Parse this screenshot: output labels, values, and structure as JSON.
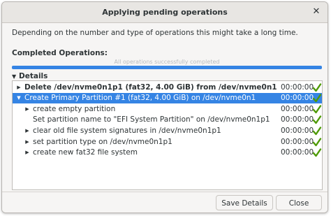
{
  "dialog": {
    "title": "Applying pending operations",
    "close_glyph": "✕",
    "message": "Depending on the number and type of operations this might take a long time."
  },
  "completed": {
    "label": "Completed Operations:",
    "status_text": "All operations successfully completed",
    "progress_percent": 100,
    "bar_color": "#3584e4"
  },
  "details": {
    "arrow": "▼",
    "label": "Details"
  },
  "operations": [
    {
      "expander": "▶",
      "label": "Delete /dev/nvme0n1p1 (fat32, 4.00 GiB) from /dev/nvme0n1",
      "time": "00:00:00",
      "level": 0,
      "bold": true,
      "selected": false,
      "icon": "check-icon"
    },
    {
      "expander": "▼",
      "label": "Create Primary Partition #1 (fat32, 4.00 GiB) on /dev/nvme0n1",
      "time": "00:00:00",
      "level": 0,
      "bold": false,
      "selected": true,
      "icon": "check-icon"
    },
    {
      "expander": "▶",
      "label": "create empty partition",
      "time": "00:00:00",
      "level": 1,
      "bold": false,
      "selected": false,
      "icon": "check-icon"
    },
    {
      "expander": "",
      "label": "Set partition name to \"EFI System Partition\" on /dev/nvme0n1p1",
      "time": "00:00:00",
      "level": 1,
      "bold": false,
      "selected": false,
      "icon": "check-icon"
    },
    {
      "expander": "▶",
      "label": "clear old file system signatures in /dev/nvme0n1p1",
      "time": "00:00:00",
      "level": 1,
      "bold": false,
      "selected": false,
      "icon": "check-icon"
    },
    {
      "expander": "▶",
      "label": "set partition type on /dev/nvme0n1p1",
      "time": "00:00:00",
      "level": 1,
      "bold": false,
      "selected": false,
      "icon": "check-icon"
    },
    {
      "expander": "▶",
      "label": "create new fat32 file system",
      "time": "00:00:00",
      "level": 1,
      "bold": false,
      "selected": false,
      "icon": "check-icon"
    }
  ],
  "buttons": {
    "save_details": "Save Details",
    "close": "Close"
  },
  "colors": {
    "check": "#4e9a06",
    "selection": "#3584e4"
  }
}
